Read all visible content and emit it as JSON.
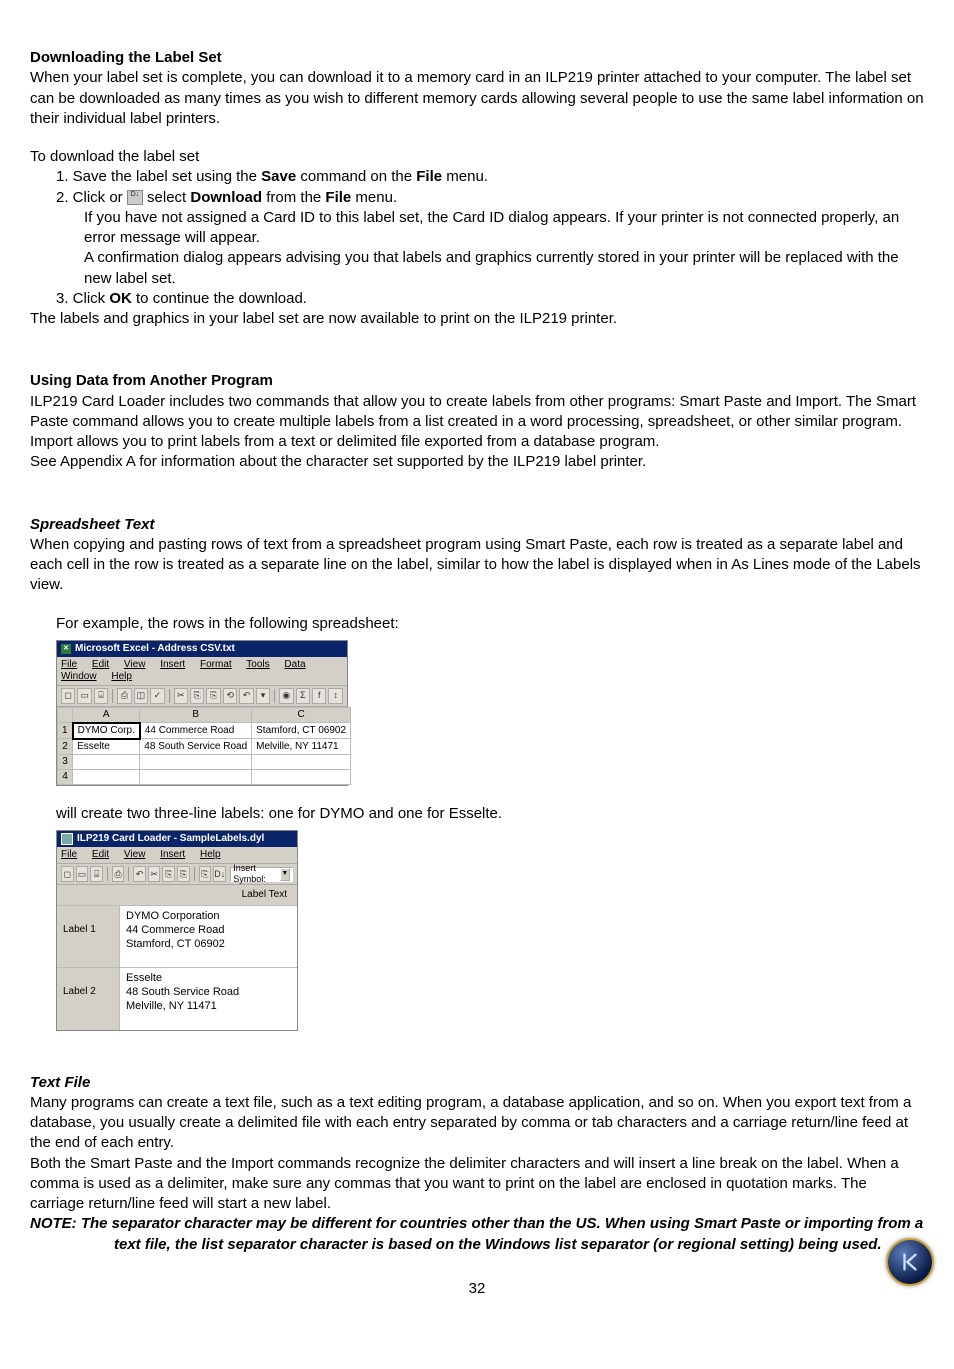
{
  "h1": "Downloading the Label Set",
  "p1": "When your label set is complete, you can download it to a memory card in an ILP219 printer attached to your computer. The label set can be downloaded as many times as you wish to different memory cards allowing several people to use the same label information on their individual label printers.",
  "p2": "To download the label set",
  "step1_pre": "1. Save the label set using the ",
  "step1_b1": "Save",
  "step1_mid": " command on the ",
  "step1_b2": "File",
  "step1_post": " menu.",
  "step2_pre": "2. Click or ",
  "step2_icon_text": "D↓",
  "step2_mid1": " select ",
  "step2_b1": "Download",
  "step2_mid2": " from the ",
  "step2_b2": "File",
  "step2_post": " menu.",
  "step2_note1": "If you have not assigned a Card ID to this label set, the Card ID dialog appears. If your printer is not connected properly, an error message will appear.",
  "step2_note2": "A confirmation dialog appears advising you that labels and graphics currently stored in your printer will be replaced with the new label set.",
  "step3_pre": "3. Click ",
  "step3_b1": "OK",
  "step3_post": " to continue the download.",
  "p3": "The labels and graphics in your label set are now available to print on the ILP219 printer.",
  "h2": "Using Data from Another Program",
  "p4": "ILP219 Card Loader includes two commands that allow you to create labels from other programs: Smart Paste and Import. The Smart Paste command allows you to create multiple labels from a list created in a word processing, spreadsheet, or other similar program. Import allows you to print labels from a text or delimited file exported from a database program.",
  "p5": "See Appendix A for information about the character set supported by the ILP219 label printer.",
  "h3": "Spreadsheet Text",
  "p6": "When copying and pasting rows of text from a spreadsheet program using Smart Paste, each row is treated as a separate label and each cell in the row is treated as a separate line on the label, similar to how the label is displayed when in As Lines mode of the Labels view.",
  "p7": "For example, the rows in the following spreadsheet:",
  "excel": {
    "title": "Microsoft Excel - Address CSV.txt",
    "menu": [
      "File",
      "Edit",
      "View",
      "Insert",
      "Format",
      "Tools",
      "Data",
      "Window",
      "Help"
    ],
    "toolbar_icons": [
      "◻",
      "▭",
      "⌸",
      "",
      "⎙",
      "◫",
      "✓",
      "",
      "✂",
      "⎘",
      "⎘",
      "⟲",
      "↶",
      "▾",
      "",
      "◉",
      "Σ",
      "f",
      "↕"
    ],
    "cols": [
      "A",
      "B",
      "C"
    ],
    "rows": [
      {
        "n": "1",
        "A": "DYMO Corp.",
        "B": "44 Commerce Road",
        "C": "Stamford, CT 06902"
      },
      {
        "n": "2",
        "A": "Esselte",
        "B": "48 South Service Road",
        "C": "Melville, NY 11471"
      },
      {
        "n": "3",
        "A": "",
        "B": "",
        "C": ""
      },
      {
        "n": "4",
        "A": "",
        "B": "",
        "C": ""
      }
    ]
  },
  "p8": "will create two three-line labels: one for DYMO and one for Esselte.",
  "loader": {
    "title": "ILP219 Card Loader - SampleLabels.dyl",
    "menu": [
      "File",
      "Edit",
      "View",
      "Insert",
      "Help"
    ],
    "toolbar_icons": [
      "◻",
      "▭",
      "⌸",
      "",
      "⎙",
      "",
      "↶",
      "✂",
      "⎘",
      "⎘",
      "",
      "⎘",
      ""
    ],
    "download_icon": "D↓",
    "combo_label": "Insert Symbol:",
    "colhdr": "Label Text",
    "labels": [
      {
        "name": "Label 1",
        "lines": [
          "DYMO Corporation",
          "44 Commerce Road",
          "Stamford, CT 06902"
        ]
      },
      {
        "name": "Label 2",
        "lines": [
          "Esselte",
          "48 South Service Road",
          "Melville, NY 11471"
        ]
      }
    ]
  },
  "h4": "Text File",
  "p9": "Many programs can create a text file, such as a text editing program, a database application, and so on. When you export text from a database, you usually create a delimited file with each entry separated by comma or tab characters and a carriage return/line feed at the end of each entry.",
  "p10": "Both the Smart Paste and the Import commands recognize the delimiter characters and will insert a line break on the label. When a comma is used as a delimiter, make sure any commas that you want to print on the label are enclosed in quotation marks. The carriage return/line feed will start a new label.",
  "note1": "NOTE: The separator character may be different for countries other than the US.  When using Smart Paste or  importing from a",
  "note2": "text file, the list separator character is based on the Windows list separator (or regional setting) being used.",
  "page_number": "32"
}
